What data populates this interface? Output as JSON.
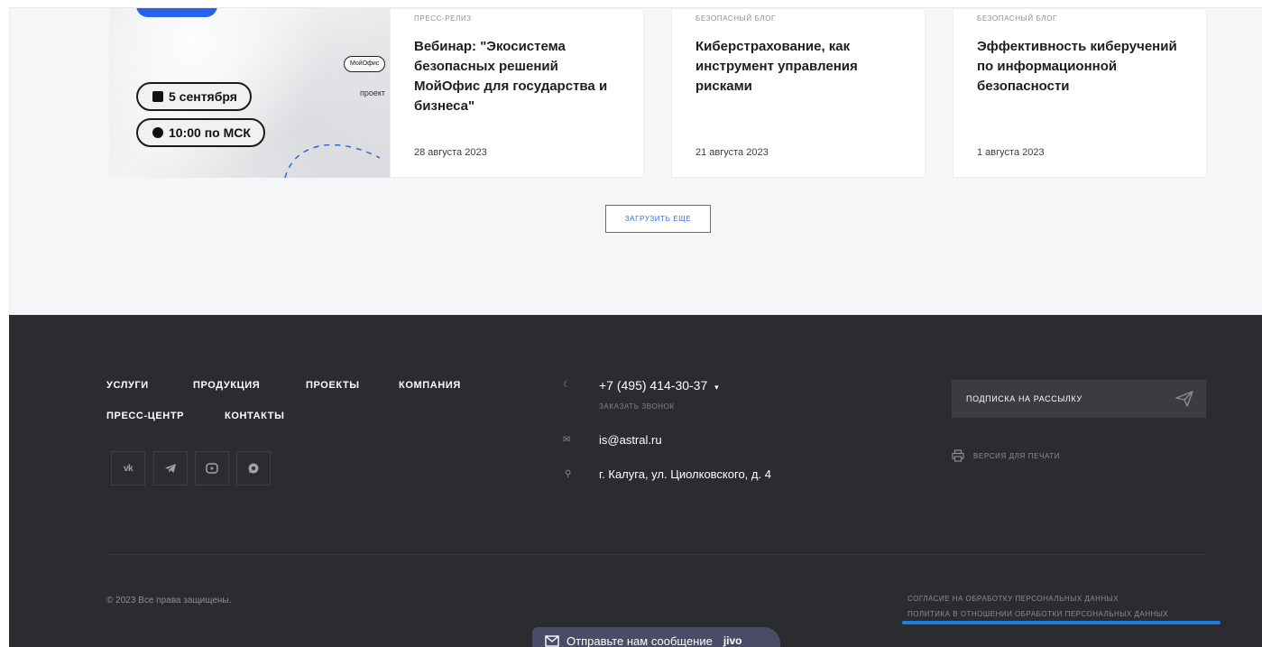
{
  "cards": [
    {
      "category": "ПРЕСС-РЕЛИЗ",
      "title": "Вебинар: \"Экосистема безопасных решений МойОфис для государства и бизнеса\"",
      "date": "28 августа 2023",
      "image": {
        "date_pill": "5 сентября",
        "time_pill": "10:00 по МСК",
        "logo": "МойОфис",
        "word": "проект"
      }
    },
    {
      "category": "БЕЗОПАСНЫЙ БЛОГ",
      "title": "Киберстрахование, как инструмент управления рисками",
      "date": "21 августа 2023"
    },
    {
      "category": "БЕЗОПАСНЫЙ БЛОГ",
      "title": "Эффективность киберучений по информационной безопасности",
      "date": "1 августа 2023"
    }
  ],
  "load_more": "ЗАГРУЗИТЬ ЕЩЕ",
  "footer": {
    "nav": [
      "УСЛУГИ",
      "ПРОДУКЦИЯ",
      "ПРОЕКТЫ",
      "КОМПАНИЯ",
      "ПРЕСС-ЦЕНТР",
      "КОНТАКТЫ"
    ],
    "social": [
      {
        "icon": "vk-icon",
        "glyph": "vk"
      },
      {
        "icon": "telegram-icon",
        "glyph": "telegram"
      },
      {
        "icon": "youtube-icon",
        "glyph": "youtube"
      },
      {
        "icon": "whatsapp-icon",
        "glyph": "whatsapp"
      }
    ],
    "phone": "+7 (495) 414-30-37",
    "callback": "ЗАКАЗАТЬ ЗВОНОК",
    "email": "is@astral.ru",
    "address": "г. Калуга, ул. Циолковского, д. 4",
    "subscribe": "ПОДПИСКА НА РАССЫЛКУ",
    "print": "ВЕРСИЯ ДЛЯ ПЕЧАТИ",
    "copyright": "© 2023 Все права защищены.",
    "legal": [
      "СОГЛАСИЕ НА ОБРАБОТКУ ПЕРСОНАЛЬНЫХ ДАННЫХ",
      "ПОЛИТИКА В ОТНОШЕНИИ ОБРАБОТКИ ПЕРСОНАЛЬНЫХ ДАННЫХ"
    ]
  },
  "chat": {
    "label": "Отправьте нам сообщение",
    "brand": "jivo"
  },
  "colors": {
    "accent": "#2563eb",
    "footer_bg": "#2b2c2f",
    "highlight": "#1a7fe0"
  }
}
